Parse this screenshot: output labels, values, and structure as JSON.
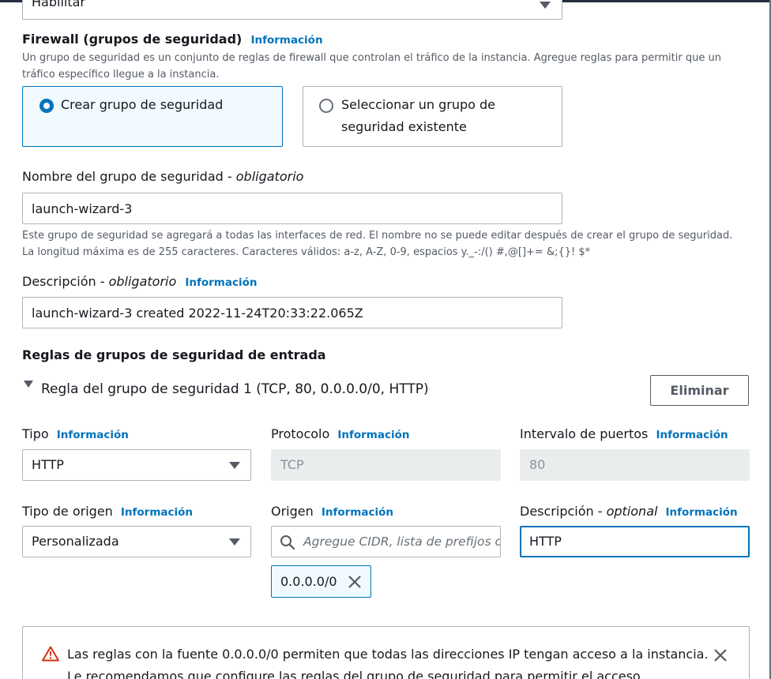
{
  "top_select": {
    "value": "Habilitar"
  },
  "firewall": {
    "title": "Firewall (grupos de seguridad)",
    "info_link": "Información",
    "description": "Un grupo de seguridad es un conjunto de reglas de firewall que controlan el tráfico de la instancia. Agregue reglas para permitir que un tráfico específico llegue a la instancia.",
    "option_create": "Crear grupo de seguridad",
    "option_select": "Seleccionar un grupo de seguridad existente",
    "selected_option": "create"
  },
  "group_name": {
    "label": "Nombre del grupo de seguridad - ",
    "label_required": "obligatorio",
    "value": "launch-wizard-3",
    "help": "Este grupo de seguridad se agregará a todas las interfaces de red. El nombre no se puede editar después de crear el grupo de seguridad. La longitud máxima es de 255 caracteres. Caracteres válidos: a-z, A-Z, 0-9, espacios y._-:/() #,@[]+= &;{}! $*"
  },
  "group_description": {
    "label": "Descripción - ",
    "label_required": "obligatorio",
    "info_link": "Información",
    "value": "launch-wizard-3 created 2022-11-24T20:33:22.065Z"
  },
  "inbound_rules": {
    "heading": "Reglas de grupos de seguridad de entrada",
    "rule_title": "Regla del grupo de seguridad 1 (TCP, 80, 0.0.0.0/0, HTTP)",
    "remove_button": "Eliminar",
    "type": {
      "label": "Tipo",
      "info": "Información",
      "value": "HTTP"
    },
    "protocol": {
      "label": "Protocolo",
      "info": "Información",
      "value": "TCP"
    },
    "port_range": {
      "label": "Intervalo de puertos",
      "info": "Información",
      "value": "80"
    },
    "source_type": {
      "label": "Tipo de origen",
      "info": "Información",
      "value": "Personalizada"
    },
    "source": {
      "label": "Origen",
      "info": "Información",
      "placeholder": "Agregue CIDR, lista de prefijos o",
      "token": "0.0.0.0/0"
    },
    "rule_description": {
      "label": "Descripción - ",
      "label_optional": "optional",
      "info": "Información",
      "value": "HTTP"
    }
  },
  "alert": {
    "line1": "Las reglas con la fuente 0.0.0.0/0 permiten que todas las direcciones IP tengan acceso a la instancia.",
    "line2": "Le recomendamos que configure las reglas del grupo de seguridad para permitir el acceso"
  },
  "colors": {
    "accent": "#0073bb",
    "warning": "#d13212",
    "border": "#aab7b8",
    "disabled_bg": "#eaeded"
  }
}
